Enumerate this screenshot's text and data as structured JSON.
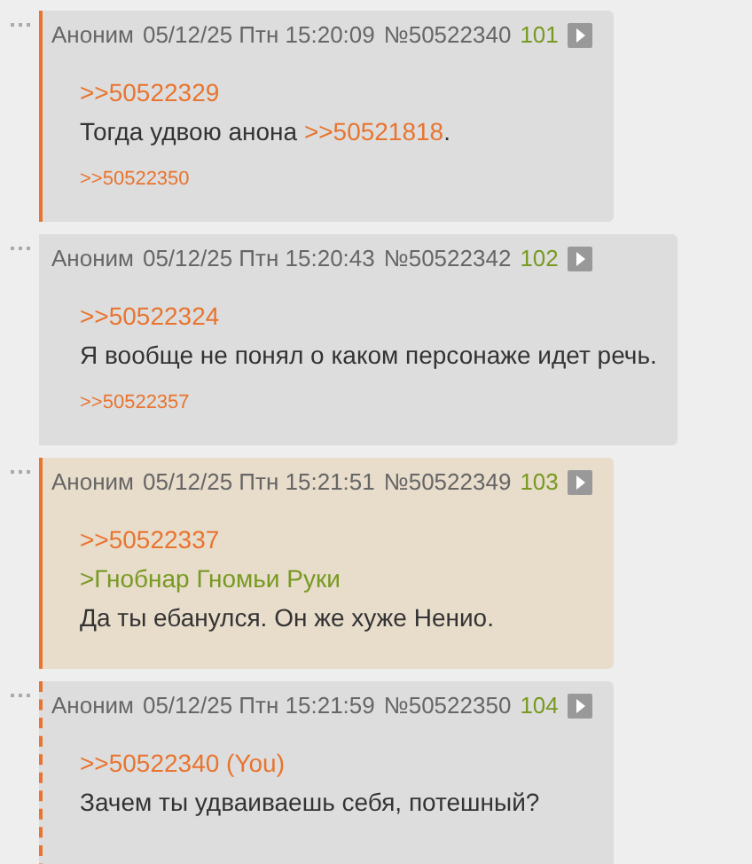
{
  "posts": [
    {
      "author": "Аноним",
      "date": "05/12/25 Птн 15:20:09",
      "number": "№50522340",
      "index": "101",
      "bordered": true,
      "dashed": false,
      "highlighted": false,
      "lines": [
        [
          {
            "kind": "link",
            "text": ">>50522329"
          }
        ],
        [
          {
            "kind": "text",
            "text": "Тогда удвою анона "
          },
          {
            "kind": "link",
            "text": ">>50521818"
          },
          {
            "kind": "text",
            "text": "."
          }
        ]
      ],
      "replies": [
        ">>50522350"
      ]
    },
    {
      "author": "Аноним",
      "date": "05/12/25 Птн 15:20:43",
      "number": "№50522342",
      "index": "102",
      "bordered": false,
      "highlighted": false,
      "lines": [
        [
          {
            "kind": "link",
            "text": ">>50522324"
          }
        ],
        [
          {
            "kind": "text",
            "text": "Я вообще не понял о каком персонаже идет речь."
          }
        ]
      ],
      "replies": [
        ">>50522357"
      ]
    },
    {
      "author": "Аноним",
      "date": "05/12/25 Птн 15:21:51",
      "number": "№50522349",
      "index": "103",
      "bordered": true,
      "dashed": false,
      "highlighted": true,
      "lines": [
        [
          {
            "kind": "link",
            "text": ">>50522337"
          }
        ],
        [
          {
            "kind": "quote",
            "text": ">Гнобнар Гномьи Руки"
          }
        ],
        [
          {
            "kind": "text",
            "text": "Да ты ебанулся. Он же хуже Ненио."
          }
        ]
      ]
    },
    {
      "author": "Аноним",
      "date": "05/12/25 Птн 15:21:59",
      "number": "№50522350",
      "index": "104",
      "bordered": true,
      "dashed": true,
      "highlighted": false,
      "lines": [
        [
          {
            "kind": "link",
            "text": ">>50522340 (You)"
          }
        ],
        [
          {
            "kind": "text",
            "text": "Зачем ты удваиваешь себя, потешный?"
          }
        ]
      ]
    }
  ]
}
